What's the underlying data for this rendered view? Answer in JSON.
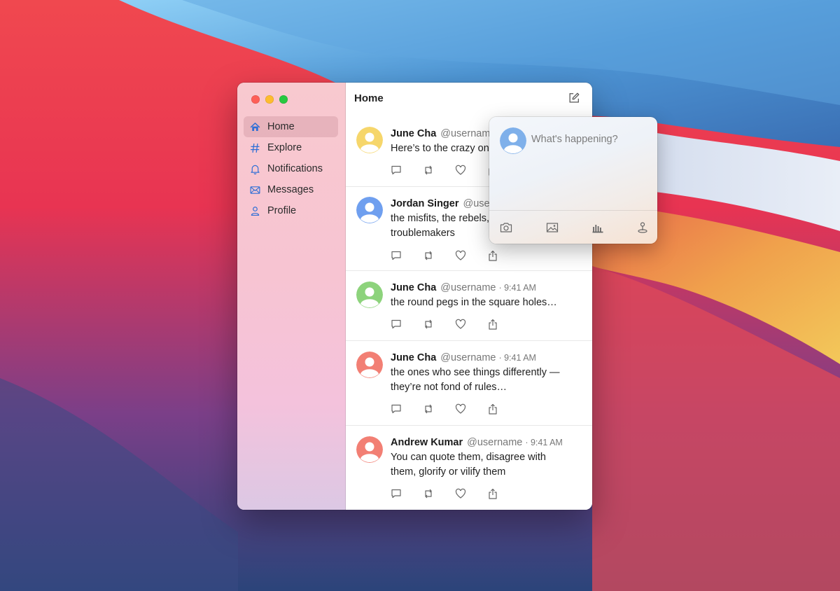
{
  "window": {
    "header_title": "Home"
  },
  "sidebar": {
    "items": [
      {
        "label": "Home",
        "icon": "house-icon",
        "active": true
      },
      {
        "label": "Explore",
        "icon": "hashtag-icon"
      },
      {
        "label": "Notifications",
        "icon": "bell-icon"
      },
      {
        "label": "Messages",
        "icon": "envelope-icon"
      },
      {
        "label": "Profile",
        "icon": "person-icon"
      }
    ]
  },
  "colors": {
    "accent": "#2f6fd6",
    "avatar_yellow": "#f6d66b",
    "avatar_blue": "#6f9fef",
    "avatar_green": "#8dd37c",
    "avatar_red": "#f27f74",
    "compose_avatar": "#7fb0ea"
  },
  "feed": {
    "tweets": [
      {
        "name": "June Cha",
        "username": "@username",
        "time": "",
        "text": "Here’s to the crazy on",
        "avatar_color": "#f6d66b"
      },
      {
        "name": "Jordan Singer",
        "username": "@user",
        "time": "",
        "text": "the misfits, the rebels, troublemakers",
        "avatar_color": "#6f9fef"
      },
      {
        "name": "June Cha",
        "username": "@username",
        "time": "· 9:41 AM",
        "text": "the round pegs in the square holes…",
        "avatar_color": "#8dd37c"
      },
      {
        "name": "June Cha",
        "username": "@username",
        "time": "· 9:41 AM",
        "text": "the ones who see things differently — they’re not fond of rules…",
        "avatar_color": "#f27f74"
      },
      {
        "name": "Andrew Kumar",
        "username": "@username",
        "time": "· 9:41 AM",
        "text": "You can quote them, disagree with them, glorify or vilify them",
        "avatar_color": "#f27f74"
      }
    ]
  },
  "compose": {
    "placeholder": "What's happening?",
    "toolbar_icons": [
      "camera-icon",
      "image-icon",
      "poll-icon",
      "location-icon"
    ]
  }
}
